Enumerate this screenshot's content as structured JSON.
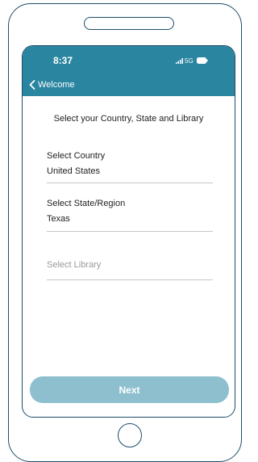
{
  "status_bar": {
    "time": "8:37",
    "network": "5G",
    "signal_icon": "signal-bars-icon",
    "battery_icon": "battery-icon"
  },
  "nav": {
    "back_label": "Welcome",
    "back_icon": "chevron-left-icon"
  },
  "heading": "Select your Country, State and Library",
  "fields": {
    "country": {
      "label": "Select Country",
      "value": "United States"
    },
    "state": {
      "label": "Select State/Region",
      "value": "Texas"
    },
    "library": {
      "placeholder": "Select Library"
    }
  },
  "next_button": {
    "label": "Next"
  },
  "colors": {
    "header": "#2a85a0",
    "button": "#8dbfce",
    "outline": "#1d4d6b"
  }
}
